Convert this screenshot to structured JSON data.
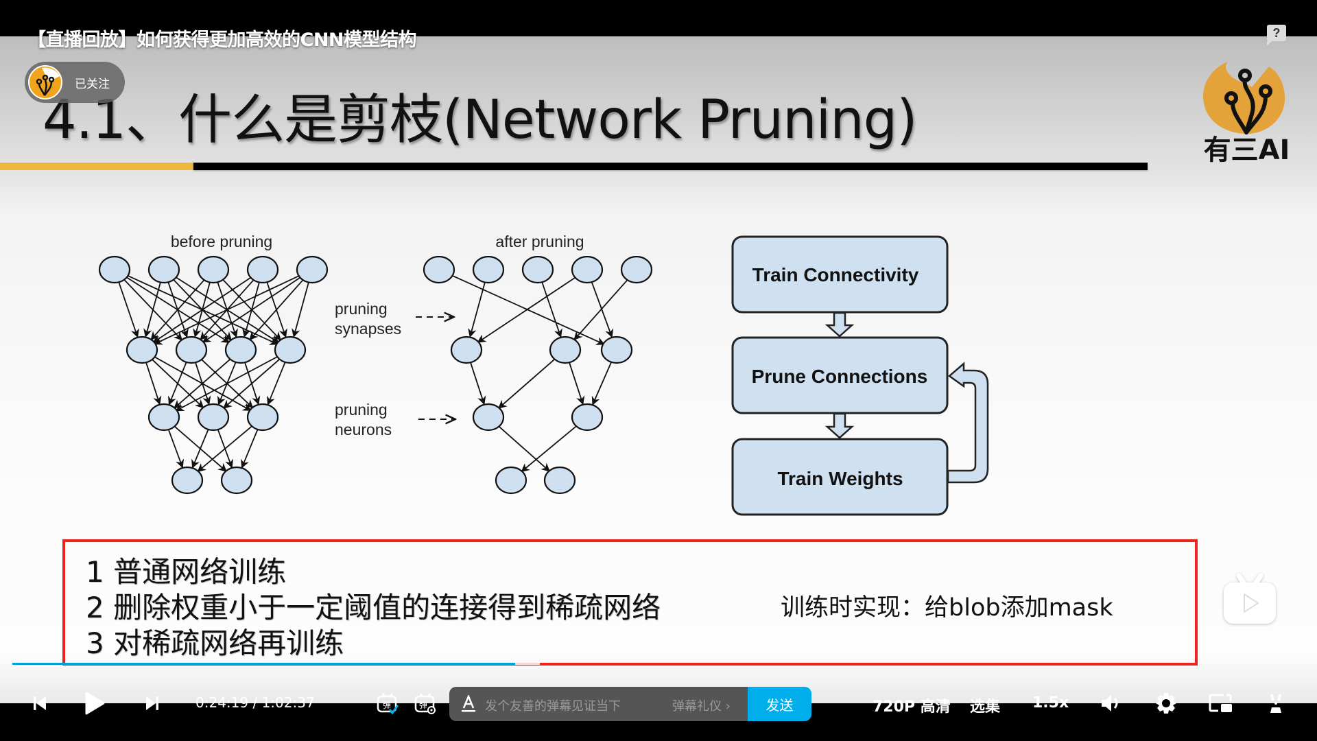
{
  "player": {
    "video_title": "【直播回放】如何获得更加高效的CNN模型结构",
    "help_label": "?",
    "follow_label": "已关注",
    "time_current": "0:24:19",
    "time_separator": "/",
    "time_total": "1:02:37",
    "progress_fraction": 0.389,
    "buffer_fraction": 0.408,
    "danmaku_placeholder": "发个友善的弹幕见证当下",
    "danmaku_etiquette": "弹幕礼仪 ›",
    "send_label": "发送",
    "quality_label": "720P 高清",
    "episodes_label": "选集",
    "speed_label": "1.5x",
    "accent_color": "#00a1d6",
    "icons": {
      "prev": "skip-previous-icon",
      "play": "play-icon",
      "next": "skip-next-icon",
      "danmaku_toggle": "danmaku-on-icon",
      "danmaku_settings": "danmaku-settings-icon",
      "text_style": "text-style-icon",
      "volume": "volume-icon",
      "settings": "gear-icon",
      "pip": "picture-in-picture-icon",
      "fullscreen": "fullscreen-icon",
      "floating_tv": "tv-play-icon"
    }
  },
  "slide": {
    "title": "4.1、什么是剪枝(Network Pruning)",
    "brand_name": "有三AI",
    "brand_color": "#e8a33a",
    "diagram": {
      "before_label": "before pruning",
      "after_label": "after pruning",
      "synapses_label_1": "pruning",
      "synapses_label_2": "synapses",
      "neurons_label_1": "pruning",
      "neurons_label_2": "neurons",
      "node_fill": "#cfe0f0",
      "before": {
        "layers": [
          5,
          4,
          3,
          2
        ],
        "fully_connected": true
      },
      "after": {
        "layers": [
          5,
          3,
          2,
          2
        ],
        "edges": [
          [
            [
              0,
              2
            ],
            [
              1,
              0
            ],
            [
              2,
              1
            ],
            [
              3,
              0
            ],
            [
              3,
              2
            ],
            [
              4,
              1
            ]
          ],
          [
            [
              0,
              0
            ],
            [
              1,
              0
            ],
            [
              1,
              1
            ],
            [
              2,
              1
            ]
          ],
          [
            [
              0,
              1
            ],
            [
              1,
              0
            ]
          ]
        ]
      }
    },
    "flow": {
      "steps": [
        "Train Connectivity",
        "Prune Connections",
        "Train Weights"
      ]
    },
    "steps": [
      "1 普通网络训练",
      "2 删除权重小于一定阈值的连接得到稀疏网络",
      "3 对稀疏网络再训练"
    ],
    "note": "训练时实现：给blob添加mask"
  }
}
